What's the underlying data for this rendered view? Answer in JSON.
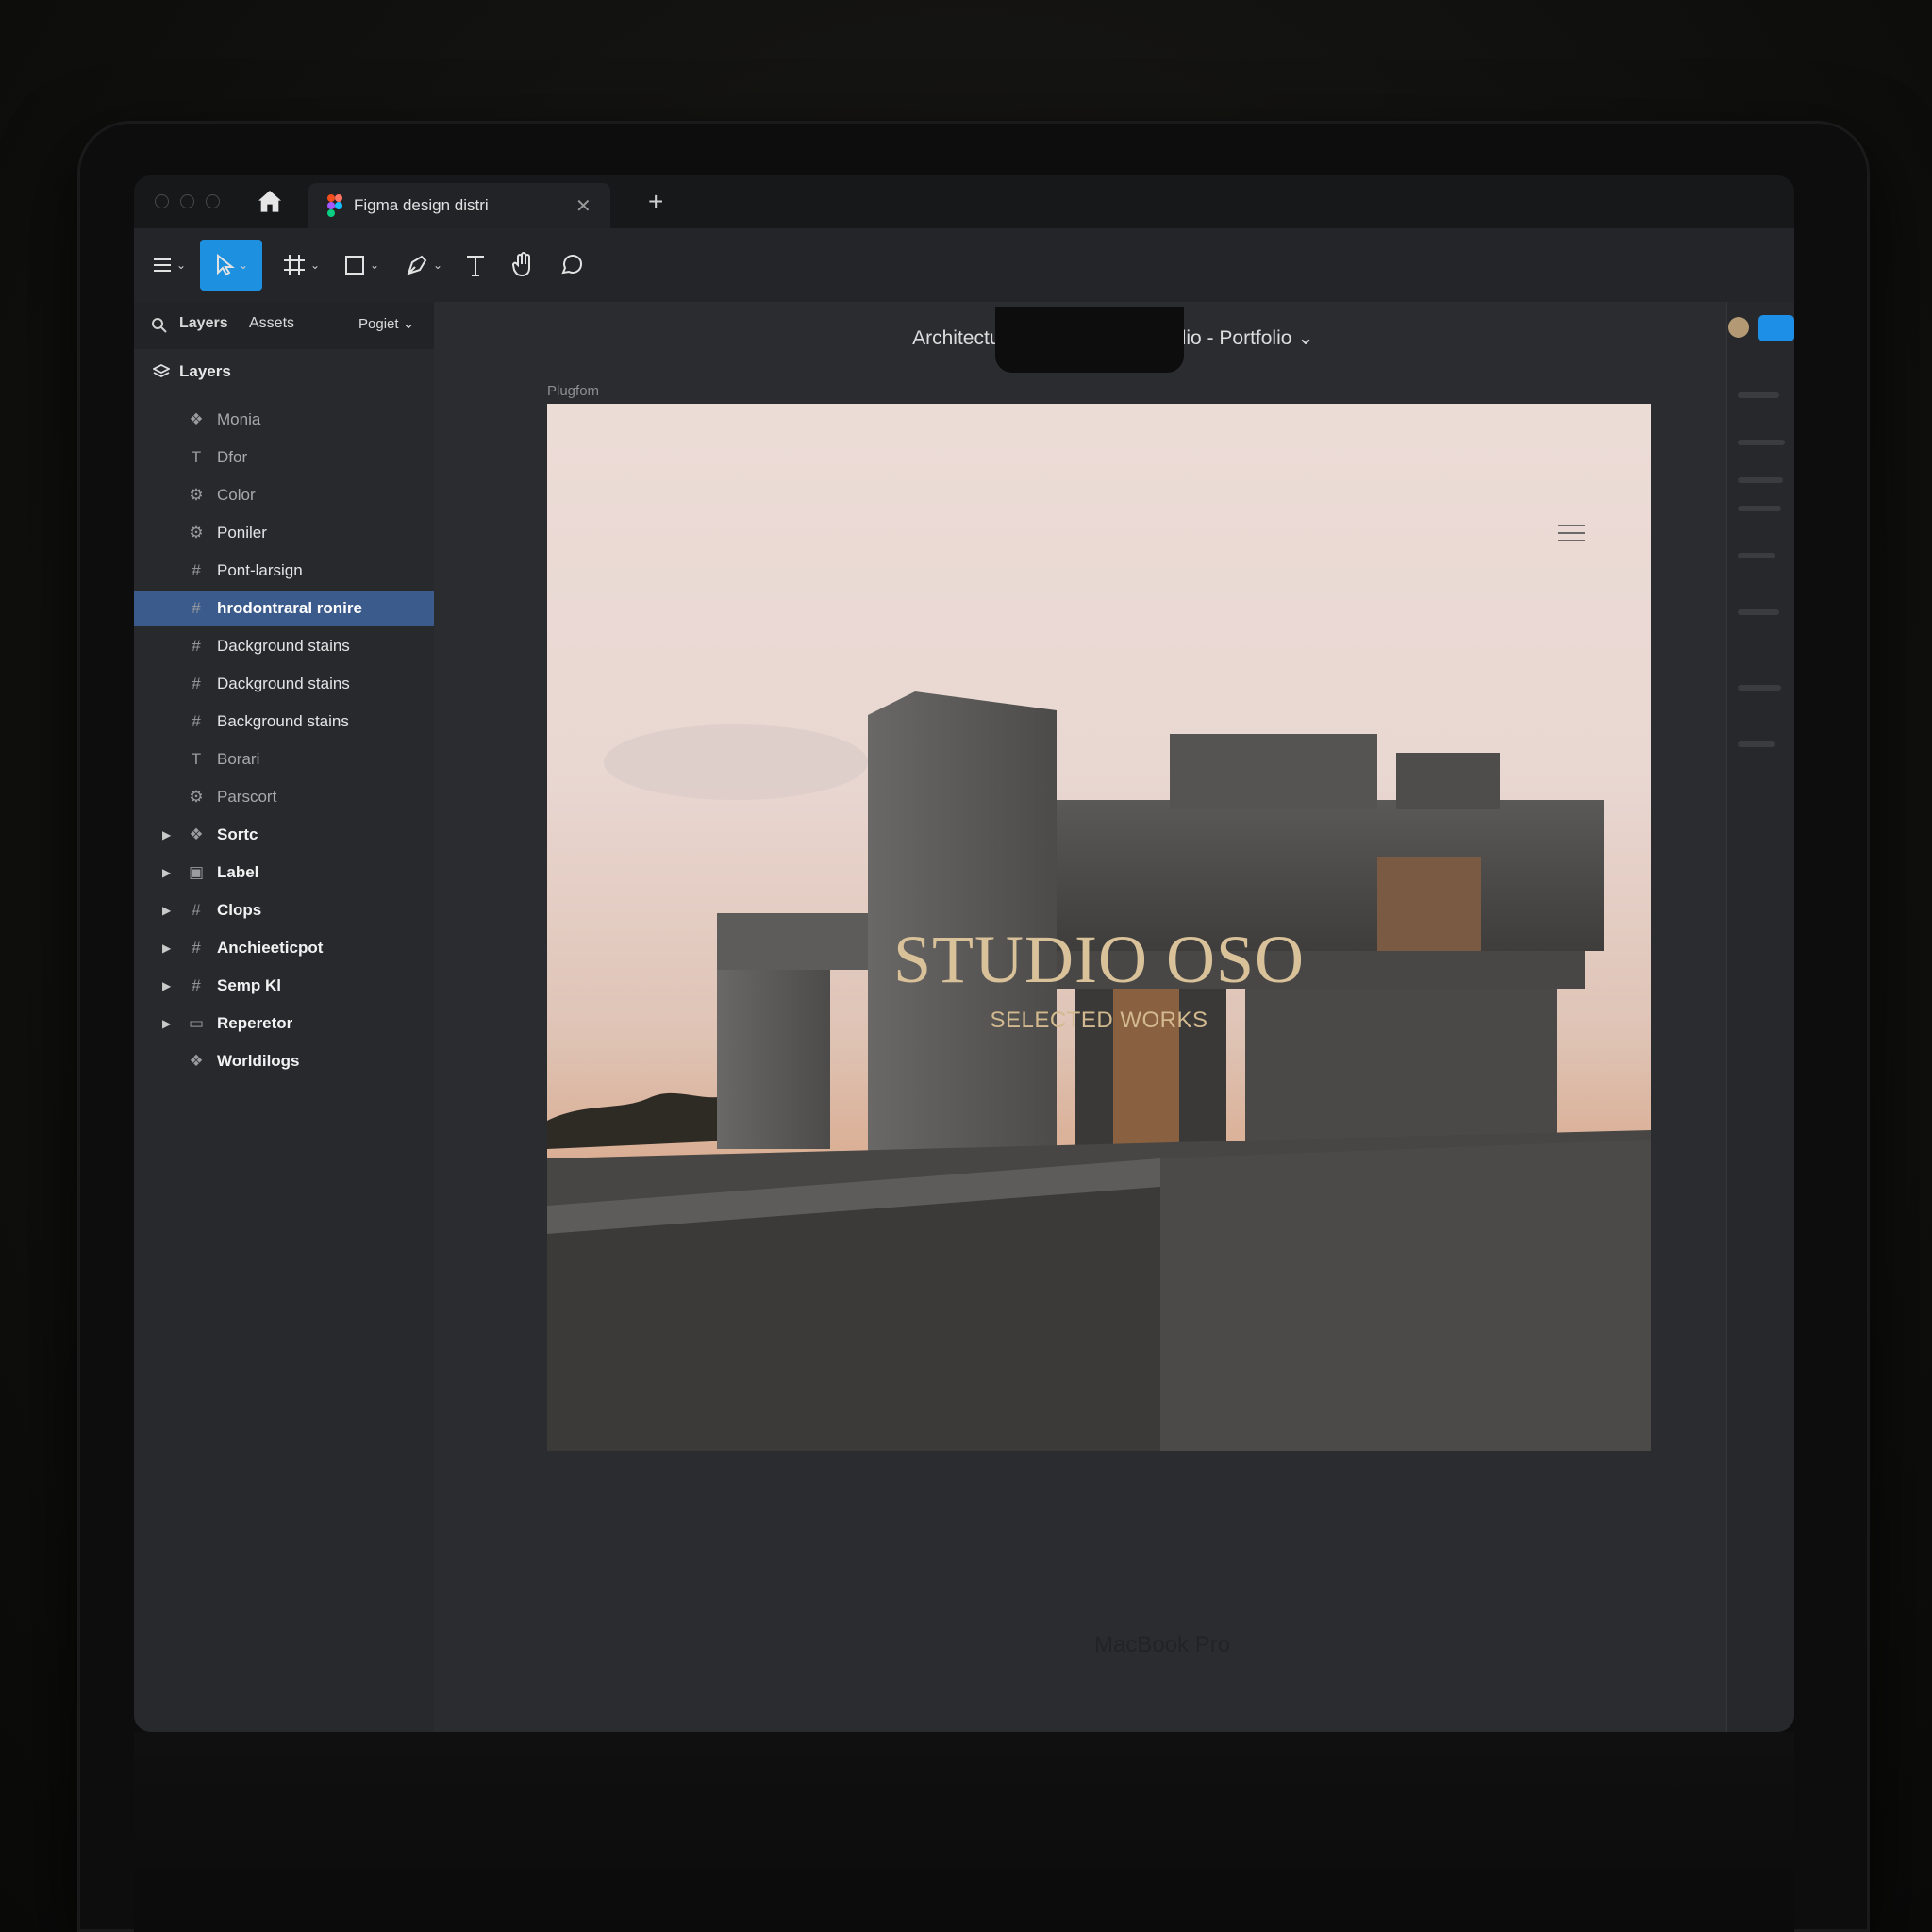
{
  "browser": {
    "tab_title": "Figma design distri",
    "new_tab": "+"
  },
  "toolbar": {
    "items": [
      "menu",
      "move",
      "frame",
      "shape",
      "pen",
      "text",
      "hand",
      "comment"
    ]
  },
  "subbar": {
    "tab_layers": "Layers",
    "tab_assets": "Assets",
    "page_selector": "Pogiet"
  },
  "layers": {
    "header": "Layers",
    "items": [
      {
        "label": "Monia",
        "icon": "component-icon",
        "style": "dim"
      },
      {
        "label": "Dfor",
        "icon": "text-icon",
        "style": "dim"
      },
      {
        "label": "Color",
        "icon": "style-icon",
        "style": "dim"
      },
      {
        "label": "Poniler",
        "icon": "style-icon",
        "style": "normal"
      },
      {
        "label": "Pont-larsign",
        "icon": "frame-icon",
        "style": "normal"
      },
      {
        "label": "hrodontraral ronire",
        "icon": "frame-icon",
        "style": "selected"
      },
      {
        "label": "Dackground stains",
        "icon": "frame-icon",
        "style": "normal"
      },
      {
        "label": "Dackground stains",
        "icon": "frame-icon",
        "style": "normal"
      },
      {
        "label": "Background stains",
        "icon": "frame-icon",
        "style": "normal"
      },
      {
        "label": "Borari",
        "icon": "text-icon",
        "style": "dim"
      },
      {
        "label": "Parscort",
        "icon": "style-icon",
        "style": "dim"
      },
      {
        "label": "Sortc",
        "icon": "component-icon",
        "style": "bold",
        "caret": true
      },
      {
        "label": "Label",
        "icon": "image-icon",
        "style": "bold",
        "caret": true
      },
      {
        "label": "Clops",
        "icon": "frame-icon",
        "style": "bold",
        "caret": true
      },
      {
        "label": "Anchieeticpot",
        "icon": "frame-icon",
        "style": "bold",
        "caret": true
      },
      {
        "label": "Semp Kl",
        "icon": "frame-icon",
        "style": "bold",
        "caret": true
      },
      {
        "label": "Reperetor",
        "icon": "folder-icon",
        "style": "bold",
        "caret": true
      },
      {
        "label": "Worldilogs",
        "icon": "component-icon",
        "style": "bold"
      }
    ]
  },
  "canvas": {
    "document_title": "Architecturial Visualization studio - Portfolio ⌄",
    "frame_label": "Plugfom",
    "hero_title": "STUDIO OSO",
    "hero_subtitle": "SELECTED WORKS"
  },
  "device": {
    "brand": "MacBook Pro"
  },
  "colors": {
    "accent": "#1e90e0",
    "selection": "#3b5b8c",
    "hero_text": "#d9c29a"
  }
}
